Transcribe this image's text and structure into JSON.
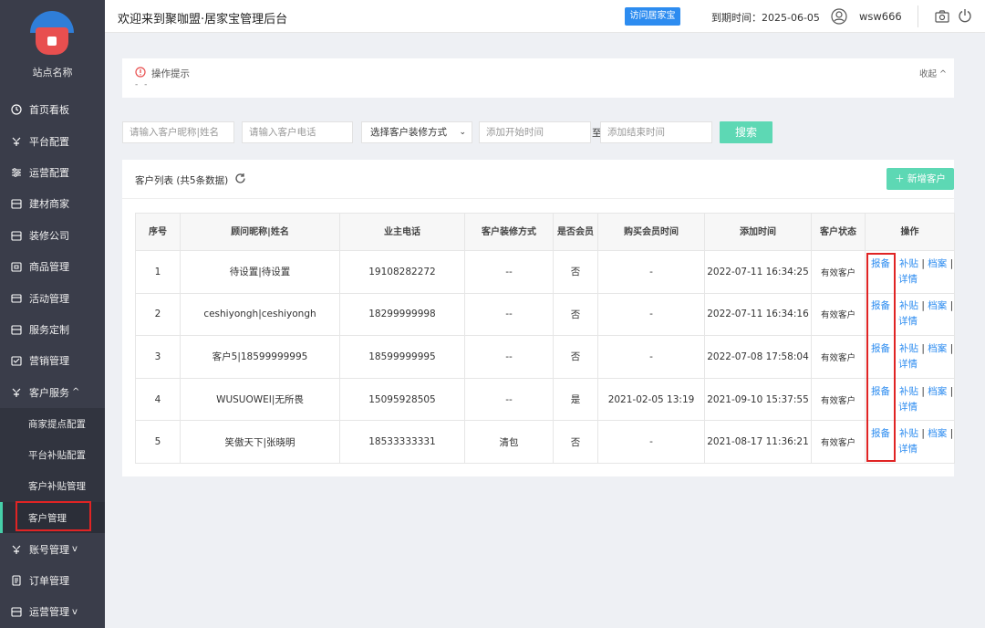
{
  "sidebar": {
    "site_name": "站点名称",
    "items": [
      {
        "label": "首页看板",
        "icon": "dashboard-icon"
      },
      {
        "label": "平台配置",
        "icon": "config-icon"
      },
      {
        "label": "运营配置",
        "icon": "sliders-icon"
      },
      {
        "label": "建材商家",
        "icon": "store-icon"
      },
      {
        "label": "装修公司",
        "icon": "company-icon"
      },
      {
        "label": "商品管理",
        "icon": "goods-icon"
      },
      {
        "label": "活动管理",
        "icon": "activity-icon"
      },
      {
        "label": "服务定制",
        "icon": "service-icon"
      },
      {
        "label": "营销管理",
        "icon": "marketing-icon"
      },
      {
        "label": "客户服务",
        "icon": "customer-service-icon",
        "arrow": "^"
      }
    ],
    "subitems": [
      {
        "label": "商家提点配置"
      },
      {
        "label": "平台补贴配置"
      },
      {
        "label": "客户补贴管理"
      },
      {
        "label": "客户管理"
      }
    ],
    "bottom_items": [
      {
        "label": "账号管理",
        "icon": "account-icon",
        "arrow": "v"
      },
      {
        "label": "订单管理",
        "icon": "order-icon"
      },
      {
        "label": "运营管理",
        "icon": "operation-icon",
        "arrow": "v"
      }
    ]
  },
  "header": {
    "welcome": "欢迎来到聚咖盟·居家宝管理后台",
    "visit_btn": "访问居家宝",
    "expire": "到期时间：2025-06-05",
    "username": "wsw666"
  },
  "tip": {
    "title": "操作提示",
    "dots": "- -",
    "collapse": "收起 ^"
  },
  "filters": {
    "nickname_placeholder": "请输入客户昵称|姓名",
    "phone_placeholder": "请输入客户电话",
    "decor_select": "选择客户装修方式",
    "start_placeholder": "添加开始时间",
    "to_label": "至",
    "end_placeholder": "添加结束时间",
    "search_btn": "搜索"
  },
  "list": {
    "title": "客户列表 (共5条数据)",
    "add_btn": "＋ 新增客户",
    "headers": [
      "序号",
      "顾问昵称|姓名",
      "业主电话",
      "客户装修方式",
      "是否会员",
      "购买会员时间",
      "添加时间",
      "客户状态",
      "操作"
    ],
    "rows": [
      {
        "no": "1",
        "name": "待设置|待设置",
        "phone": "19108282272",
        "decor": "--",
        "member": "否",
        "buy_time": "-",
        "add_time": "2022-07-11 16:34:25",
        "status": "有效客户"
      },
      {
        "no": "2",
        "name": "ceshiyongh|ceshiyongh",
        "phone": "18299999998",
        "decor": "--",
        "member": "否",
        "buy_time": "-",
        "add_time": "2022-07-11 16:34:16",
        "status": "有效客户"
      },
      {
        "no": "3",
        "name": "客户5|18599999995",
        "phone": "18599999995",
        "decor": "--",
        "member": "否",
        "buy_time": "-",
        "add_time": "2022-07-08 17:58:04",
        "status": "有效客户"
      },
      {
        "no": "4",
        "name": "WUSUOWEI|无所畏",
        "phone": "15095928505",
        "decor": "--",
        "member": "是",
        "buy_time": "2021-02-05 13:19",
        "add_time": "2021-09-10 15:37:55",
        "status": "有效客户"
      },
      {
        "no": "5",
        "name": "笑傲天下|张晓明",
        "phone": "18533333331",
        "decor": "清包",
        "member": "否",
        "buy_time": "-",
        "add_time": "2021-08-17 11:36:21",
        "status": "有效客户"
      }
    ],
    "ops": {
      "report": "报备",
      "subsidy": "补贴",
      "archive": "档案",
      "detail": "详情",
      "sep": "|"
    }
  },
  "colors": {
    "sidebar_bg": "#3a3d4a",
    "accent": "#5dd8b4",
    "link": "#2d8cf0",
    "highlight": "#e02424"
  }
}
